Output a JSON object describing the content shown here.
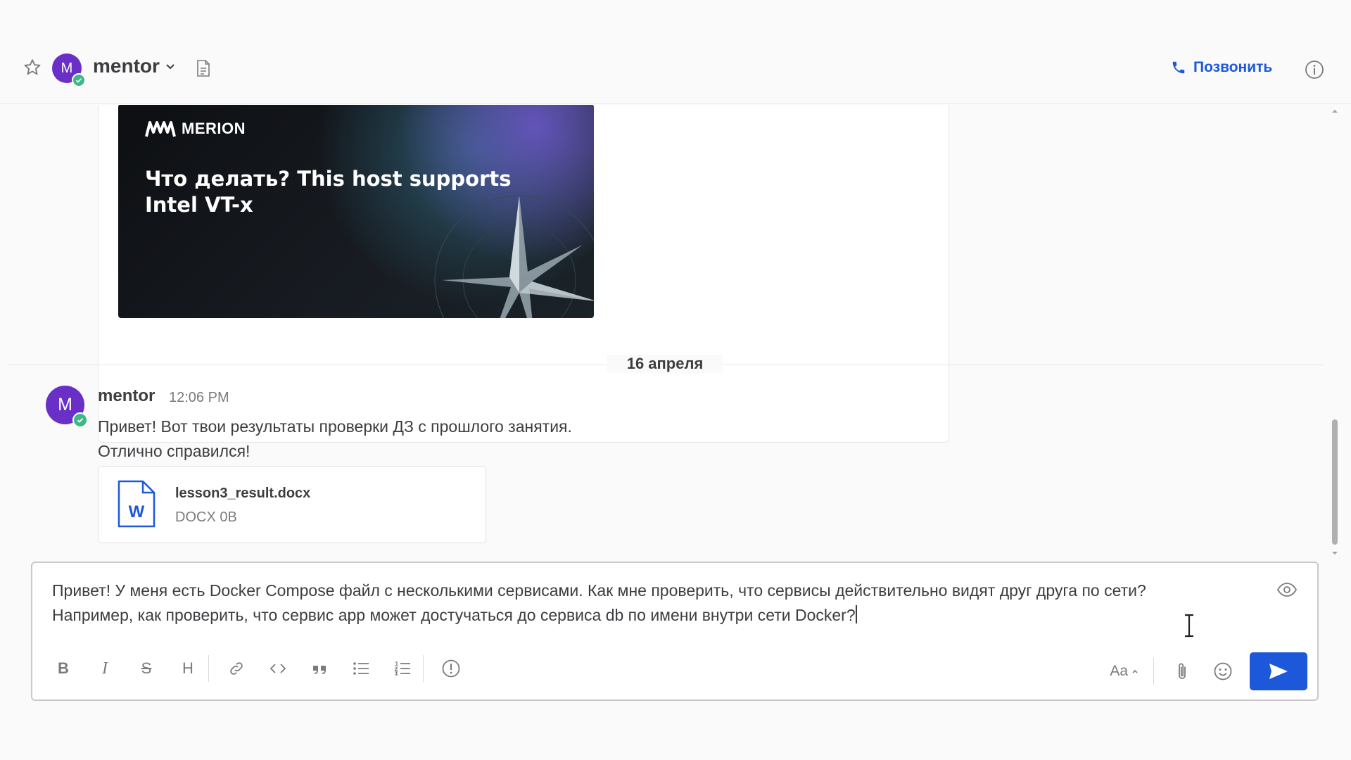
{
  "header": {
    "channel_name": "mentor",
    "avatar_letter": "M",
    "call_label": "Позвонить"
  },
  "feed": {
    "banner": {
      "logo_text": "MERION",
      "title": "Что делать? This host supports Intel VT-x"
    },
    "date_divider": "16 апреля",
    "message": {
      "author": "mentor",
      "avatar_letter": "M",
      "time": "12:06 PM",
      "lines": [
        "Привет! Вот твои результаты проверки ДЗ с прошлого занятия.",
        "Отлично справился!"
      ],
      "attachment": {
        "file_name": "lesson3_result.docx",
        "file_meta": "DOCX 0B",
        "icon_letter": "W"
      }
    }
  },
  "composer": {
    "text_line1": "Привет! У меня есть Docker Compose файл с несколькими сервисами. Как мне проверить, что сервисы действительно видят друг друга по сети?",
    "text_line2": "Например, как проверить, что сервис app может достучаться до сервиса db по имени внутри сети Docker?",
    "toolbar": {
      "bold": "B",
      "italic": "I",
      "strike": "S",
      "heading": "H",
      "font_size_toggle": "Aa"
    }
  },
  "colors": {
    "accent": "#1c58d9",
    "avatar": "#6a2fc6",
    "online": "#3db887"
  }
}
